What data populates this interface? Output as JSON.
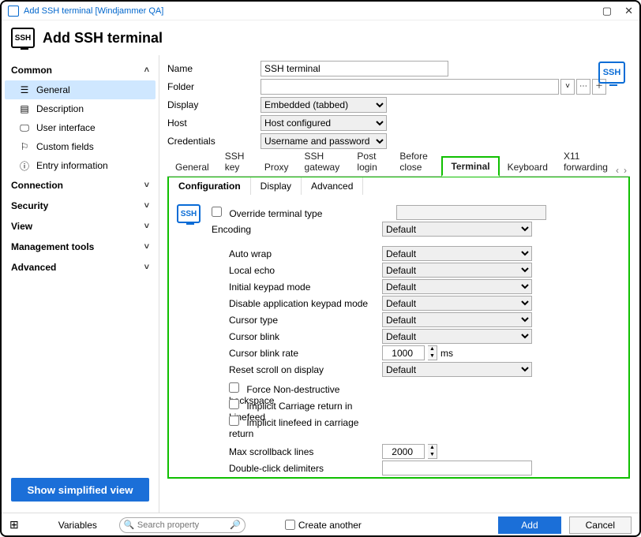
{
  "titlebar": {
    "text": "Add SSH terminal [Windjammer QA]"
  },
  "header": {
    "icon_text": "SSH",
    "title": "Add SSH terminal"
  },
  "sidebar": {
    "sections": [
      {
        "label": "Common",
        "expanded": true,
        "chev": "˄",
        "items": [
          {
            "label": "General",
            "icon": "menu",
            "selected": true
          },
          {
            "label": "Description",
            "icon": "doc"
          },
          {
            "label": "User interface",
            "icon": "screen"
          },
          {
            "label": "Custom fields",
            "icon": "tag"
          },
          {
            "label": "Entry information",
            "icon": "info"
          }
        ]
      },
      {
        "label": "Connection",
        "expanded": false,
        "chev": "˅"
      },
      {
        "label": "Security",
        "expanded": false,
        "chev": "˅"
      },
      {
        "label": "View",
        "expanded": false,
        "chev": "˅"
      },
      {
        "label": "Management tools",
        "expanded": false,
        "chev": "˅"
      },
      {
        "label": "Advanced",
        "expanded": false,
        "chev": "˅"
      }
    ],
    "simplified_button": "Show simplified view"
  },
  "top_form": {
    "name_label": "Name",
    "name_value": "SSH terminal",
    "folder_label": "Folder",
    "folder_value": "",
    "display_label": "Display",
    "display_value": "Embedded (tabbed)",
    "host_label": "Host",
    "host_value": "Host configured",
    "credentials_label": "Credentials",
    "credentials_value": "Username and password",
    "corner_icon_text": "SSH"
  },
  "tabs": {
    "items": [
      "General",
      "SSH key",
      "Proxy",
      "SSH gateway",
      "Post login",
      "Before close",
      "Terminal",
      "Keyboard",
      "X11 forwarding"
    ],
    "active": "Terminal"
  },
  "subtabs": {
    "items": [
      "Configuration",
      "Display",
      "Advanced"
    ],
    "active": "Configuration"
  },
  "config": {
    "mini_icon_text": "SSH",
    "override_label": "Override terminal type",
    "encoding_label": "Encoding",
    "encoding_value": "Default",
    "auto_wrap_label": "Auto wrap",
    "auto_wrap_value": "Default",
    "local_echo_label": "Local echo",
    "local_echo_value": "Default",
    "initial_keypad_label": "Initial keypad mode",
    "initial_keypad_value": "Default",
    "disable_keypad_label": "Disable application keypad mode",
    "disable_keypad_value": "Default",
    "cursor_type_label": "Cursor type",
    "cursor_type_value": "Default",
    "cursor_blink_label": "Cursor blink",
    "cursor_blink_value": "Default",
    "cursor_blink_rate_label": "Cursor blink rate",
    "cursor_blink_rate_value": "1000",
    "cursor_blink_rate_unit": "ms",
    "reset_scroll_label": "Reset scroll on display",
    "reset_scroll_value": "Default",
    "force_backspace_label": "Force Non-destructive backspace",
    "implicit_cr_lf_label": "Implicit Carriage return in Linefeed",
    "implicit_lf_cr_label": "Implicit linefeed in carriage return",
    "max_scrollback_label": "Max scrollback lines",
    "max_scrollback_value": "2000",
    "double_click_label": "Double-click delimiters",
    "double_click_value": ""
  },
  "footer": {
    "variables_label": "Variables",
    "search_placeholder": "Search property",
    "create_another_label": "Create another",
    "add_label": "Add",
    "cancel_label": "Cancel"
  }
}
